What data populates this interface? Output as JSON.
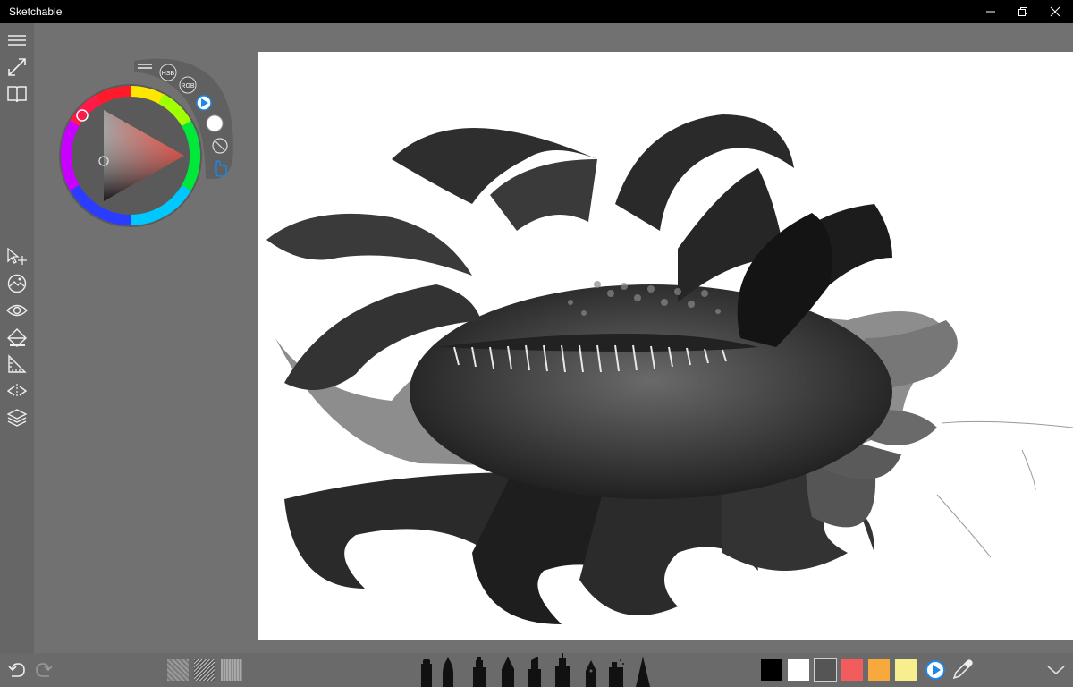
{
  "app": {
    "title": "Sketchable"
  },
  "window_controls": [
    "minimize",
    "restore",
    "close"
  ],
  "color_wheel": {
    "modes": [
      "HSB",
      "RGB"
    ],
    "current_color": "#ffffff"
  },
  "left_tools": [
    "menu-icon",
    "expand-icon",
    "journal-icon",
    "select-move-icon",
    "image-icon",
    "view-icon",
    "fill-icon",
    "ruler-icon",
    "mirror-icon",
    "layers-icon"
  ],
  "bottom": {
    "textures": [
      "texture-1",
      "texture-2",
      "texture-3"
    ],
    "palette": [
      "#000000",
      "#ffffff",
      "#555555",
      "#f25c5c",
      "#f7a93d",
      "#f7ee8e"
    ]
  }
}
